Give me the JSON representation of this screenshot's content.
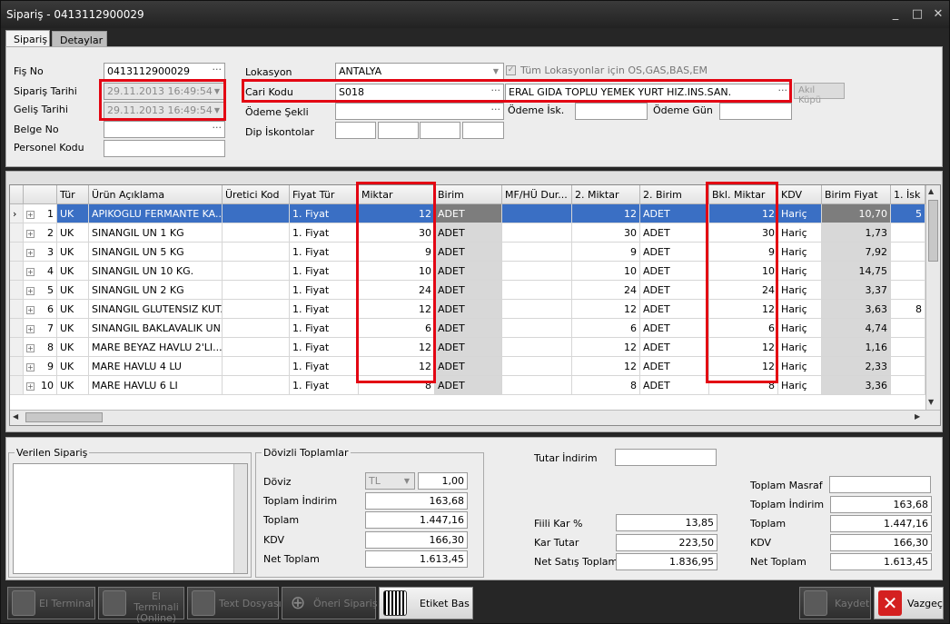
{
  "window": {
    "title": "Sipariş - 0413112900029",
    "min": "_",
    "max": "□",
    "close": "✕"
  },
  "tabs": [
    "Sipariş",
    "Detaylar"
  ],
  "header": {
    "fis_no_label": "Fiş No",
    "fis_no": "0413112900029",
    "siparis_tarihi_label": "Sipariş Tarihi",
    "siparis_tarihi": "29.11.2013 16:49:54",
    "gelis_tarihi_label": "Geliş Tarihi",
    "gelis_tarihi": "29.11.2013 16:49:54",
    "belge_no_label": "Belge No",
    "belge_no": "",
    "personel_kodu_label": "Personel Kodu",
    "personel_kodu": "",
    "lokasyon_label": "Lokasyon",
    "lokasyon": "ANTALYA",
    "tum_lok_label": "Tüm Lokasyonlar için OS,GAS,BAS,EM",
    "cari_kodu_label": "Cari Kodu",
    "cari_kodu": "S018",
    "cari_adi": "ERAL GIDA TOPLU YEMEK YURT HIZ.INS.SAN.",
    "akil_kupu": "Akıl Küpü",
    "odeme_sekli_label": "Ödeme Şekli",
    "odeme_isk_label": "Ödeme İsk.",
    "odeme_gun_label": "Ödeme Gün",
    "dip_iskontolar_label": "Dip İskontolar",
    "dots": "···"
  },
  "grid": {
    "columns": [
      "Tür",
      "Ürün Açıklama",
      "Üretici Kod",
      "Fiyat Tür",
      "Miktar",
      "Birim",
      "MF/HÜ Dur...",
      "2. Miktar",
      "2. Birim",
      "Bkl. Miktar",
      "KDV",
      "Birim Fiyat",
      "1. İsk"
    ],
    "rows": [
      {
        "n": "1",
        "tur": "UK",
        "urun": "APIKOGLU FERMANTE KA...",
        "fiyat_tur": "1. Fiyat",
        "miktar": "12",
        "birim": "ADET",
        "miktar2": "12",
        "birim2": "ADET",
        "bkl": "12",
        "kdv": "Hariç",
        "fiyat": "10,70",
        "isk": "5"
      },
      {
        "n": "2",
        "tur": "UK",
        "urun": "SINANGIL UN 1 KG",
        "fiyat_tur": "1. Fiyat",
        "miktar": "30",
        "birim": "ADET",
        "miktar2": "30",
        "birim2": "ADET",
        "bkl": "30",
        "kdv": "Hariç",
        "fiyat": "1,73",
        "isk": ""
      },
      {
        "n": "3",
        "tur": "UK",
        "urun": "SINANGIL UN 5 KG",
        "fiyat_tur": "1. Fiyat",
        "miktar": "9",
        "birim": "ADET",
        "miktar2": "9",
        "birim2": "ADET",
        "bkl": "9",
        "kdv": "Hariç",
        "fiyat": "7,92",
        "isk": ""
      },
      {
        "n": "4",
        "tur": "UK",
        "urun": "SINANGIL UN 10 KG.",
        "fiyat_tur": "1. Fiyat",
        "miktar": "10",
        "birim": "ADET",
        "miktar2": "10",
        "birim2": "ADET",
        "bkl": "10",
        "kdv": "Hariç",
        "fiyat": "14,75",
        "isk": ""
      },
      {
        "n": "5",
        "tur": "UK",
        "urun": "SINANGIL UN 2 KG",
        "fiyat_tur": "1. Fiyat",
        "miktar": "24",
        "birim": "ADET",
        "miktar2": "24",
        "birim2": "ADET",
        "bkl": "24",
        "kdv": "Hariç",
        "fiyat": "3,37",
        "isk": ""
      },
      {
        "n": "6",
        "tur": "UK",
        "urun": "SINANGIL GLUTENSIZ KUT...",
        "fiyat_tur": "1. Fiyat",
        "miktar": "12",
        "birim": "ADET",
        "miktar2": "12",
        "birim2": "ADET",
        "bkl": "12",
        "kdv": "Hariç",
        "fiyat": "3,63",
        "isk": "8"
      },
      {
        "n": "7",
        "tur": "UK",
        "urun": "SINANGIL BAKLAVALIK UN...",
        "fiyat_tur": "1. Fiyat",
        "miktar": "6",
        "birim": "ADET",
        "miktar2": "6",
        "birim2": "ADET",
        "bkl": "6",
        "kdv": "Hariç",
        "fiyat": "4,74",
        "isk": ""
      },
      {
        "n": "8",
        "tur": "UK",
        "urun": "MARE BEYAZ HAVLU 2'LI....",
        "fiyat_tur": "1. Fiyat",
        "miktar": "12",
        "birim": "ADET",
        "miktar2": "12",
        "birim2": "ADET",
        "bkl": "12",
        "kdv": "Hariç",
        "fiyat": "1,16",
        "isk": ""
      },
      {
        "n": "9",
        "tur": "UK",
        "urun": "MARE HAVLU 4 LU",
        "fiyat_tur": "1. Fiyat",
        "miktar": "12",
        "birim": "ADET",
        "miktar2": "12",
        "birim2": "ADET",
        "bkl": "12",
        "kdv": "Hariç",
        "fiyat": "2,33",
        "isk": ""
      },
      {
        "n": "10",
        "tur": "UK",
        "urun": "MARE HAVLU 6 LI",
        "fiyat_tur": "1. Fiyat",
        "miktar": "8",
        "birim": "ADET",
        "miktar2": "8",
        "birim2": "ADET",
        "bkl": "8",
        "kdv": "Hariç",
        "fiyat": "3,36",
        "isk": ""
      }
    ]
  },
  "bottom": {
    "verilen_siparis": "Verilen Sipariş",
    "dovizli": "Dövizli Toplamlar",
    "doviz_label": "Döviz",
    "doviz_cur": "TL",
    "doviz_val": "1,00",
    "toplam_indirim_label": "Toplam İndirim",
    "toplam_indirim": "163,68",
    "toplam_label": "Toplam",
    "toplam": "1.447,16",
    "kdv_label": "KDV",
    "kdv": "166,30",
    "net_toplam_label": "Net Toplam",
    "net_toplam": "1.613,45",
    "tutar_indirim_label": "Tutar İndirim",
    "fiili_kar_label": "Fiili Kar %",
    "fiili_kar": "13,85",
    "kar_tutar_label": "Kar Tutar",
    "kar_tutar": "223,50",
    "net_satis_label": "Net Satış Toplam",
    "net_satis": "1.836,95",
    "toplam_masraf_label": "Toplam Masraf",
    "r_toplam_indirim": "163,68",
    "r_toplam": "1.447,16",
    "r_kdv": "166,30",
    "r_net_toplam": "1.613,45"
  },
  "buttons": {
    "el_terminali": "El Terminali",
    "el_terminali_online": "El Terminali (Online)",
    "text_dosyasi": "Text Dosyası",
    "oneri_siparis": "Öneri Sipariş",
    "etiket_bas": "Etiket Bas",
    "kaydet": "Kaydet",
    "vazgec": "Vazgeç"
  }
}
